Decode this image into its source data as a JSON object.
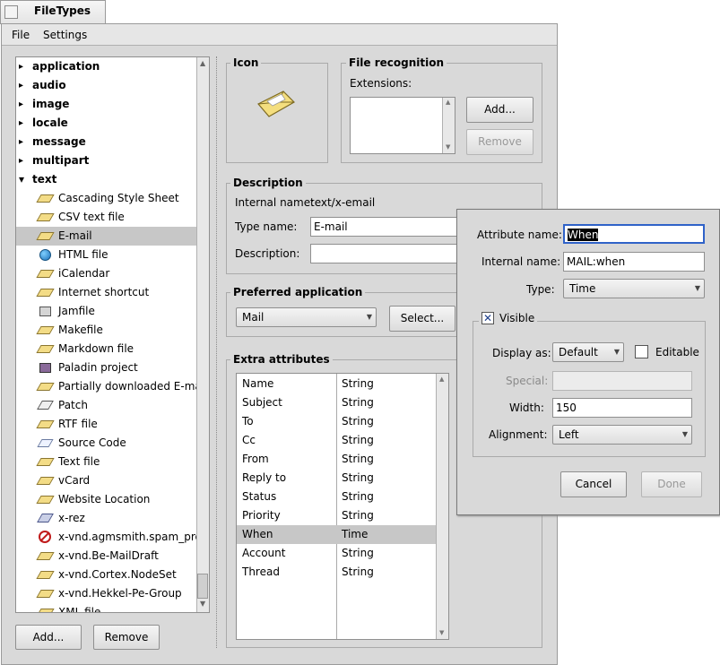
{
  "window": {
    "title": "FileTypes"
  },
  "menu": [
    {
      "label": "File"
    },
    {
      "label": "Settings"
    }
  ],
  "tree": [
    {
      "label": "application",
      "kind": "cat"
    },
    {
      "label": "audio",
      "kind": "cat"
    },
    {
      "label": "image",
      "kind": "cat"
    },
    {
      "label": "locale",
      "kind": "cat"
    },
    {
      "label": "message",
      "kind": "cat"
    },
    {
      "label": "multipart",
      "kind": "cat"
    },
    {
      "label": "text",
      "kind": "cat",
      "open": true
    },
    {
      "label": "Cascading Style Sheet",
      "icon": "document-icon"
    },
    {
      "label": "CSV text file",
      "icon": "document-icon"
    },
    {
      "label": "E-mail",
      "icon": "email-icon",
      "selected": true
    },
    {
      "label": "HTML file",
      "icon": "globe-icon"
    },
    {
      "label": "iCalendar",
      "icon": "document-icon"
    },
    {
      "label": "Internet shortcut",
      "icon": "document-icon"
    },
    {
      "label": "Jamfile",
      "icon": "jamfile-icon"
    },
    {
      "label": "Makefile",
      "icon": "document-icon"
    },
    {
      "label": "Markdown file",
      "icon": "document-icon"
    },
    {
      "label": "Paladin project",
      "icon": "project-icon"
    },
    {
      "label": "Partially downloaded E-mail",
      "icon": "email-icon"
    },
    {
      "label": "Patch",
      "icon": "patch-icon"
    },
    {
      "label": "RTF file",
      "icon": "document-icon"
    },
    {
      "label": "Source Code",
      "icon": "source-icon"
    },
    {
      "label": "Text file",
      "icon": "document-icon"
    },
    {
      "label": "vCard",
      "icon": "document-icon"
    },
    {
      "label": "Website Location",
      "icon": "document-icon"
    },
    {
      "label": "x-rez",
      "icon": "rez-icon"
    },
    {
      "label": "x-vnd.agmsmith.spam_probabilities",
      "icon": "no-spam-icon"
    },
    {
      "label": "x-vnd.Be-MailDraft",
      "icon": "document-icon"
    },
    {
      "label": "x-vnd.Cortex.NodeSet",
      "icon": "document-icon"
    },
    {
      "label": "x-vnd.Hekkel-Pe-Group",
      "icon": "document-icon"
    },
    {
      "label": "XML file",
      "icon": "document-icon"
    }
  ],
  "left_buttons": {
    "add": "Add...",
    "remove": "Remove"
  },
  "icon_box": {
    "title": "Icon"
  },
  "recognition": {
    "title": "File recognition",
    "extensions_label": "Extensions:",
    "add": "Add...",
    "remove": "Remove"
  },
  "description": {
    "title": "Description",
    "internal_label": "Internal name:",
    "internal_value": "text/x-email",
    "type_label": "Type name:",
    "type_value": "E-mail",
    "desc_label": "Description:",
    "desc_value": ""
  },
  "preferred": {
    "title": "Preferred application",
    "app": "Mail",
    "select": "Select..."
  },
  "extra": {
    "title": "Extra attributes",
    "rows": [
      {
        "name": "Name",
        "type": "String"
      },
      {
        "name": "Subject",
        "type": "String"
      },
      {
        "name": "To",
        "type": "String"
      },
      {
        "name": "Cc",
        "type": "String"
      },
      {
        "name": "From",
        "type": "String"
      },
      {
        "name": "Reply to",
        "type": "String"
      },
      {
        "name": "Status",
        "type": "String"
      },
      {
        "name": "Priority",
        "type": "String"
      },
      {
        "name": "When",
        "type": "Time",
        "selected": true
      },
      {
        "name": "Account",
        "type": "String"
      },
      {
        "name": "Thread",
        "type": "String"
      }
    ]
  },
  "popup": {
    "attr_name_label": "Attribute name:",
    "attr_name_value": "When",
    "internal_label": "Internal name:",
    "internal_value": "MAIL:when",
    "type_label": "Type:",
    "type_value": "Time",
    "visible_label": "Visible",
    "visible_checked": true,
    "display_label": "Display as:",
    "display_value": "Default",
    "editable_label": "Editable",
    "editable_checked": false,
    "special_label": "Special:",
    "special_value": "",
    "width_label": "Width:",
    "width_value": "150",
    "alignment_label": "Alignment:",
    "alignment_value": "Left",
    "cancel": "Cancel",
    "done": "Done"
  }
}
